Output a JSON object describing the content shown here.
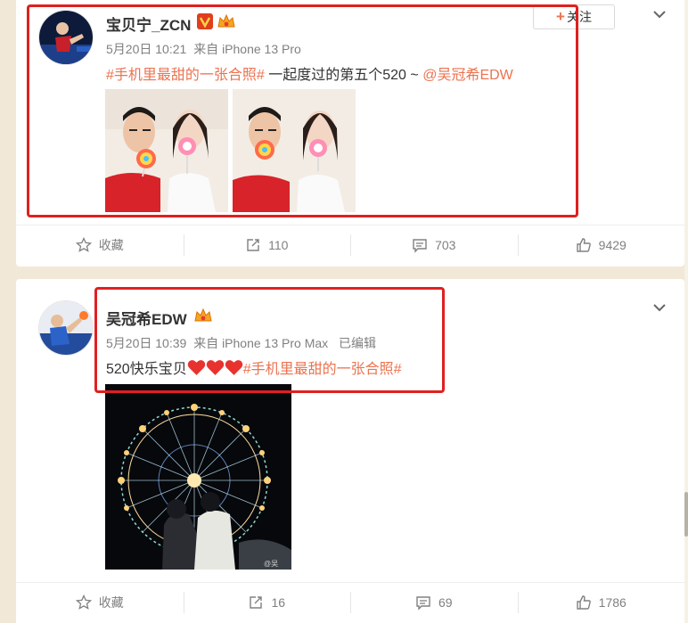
{
  "posts": [
    {
      "author": "宝贝宁_ZCN",
      "time": "5月20日 10:21",
      "source": "来自 iPhone 13 Pro",
      "text_topic": "#手机里最甜的一张合照#",
      "text_body": " 一起度过的第五个520 ~ ",
      "text_mention": "@吴冠希EDW",
      "follow_label": "关注",
      "actions": {
        "fav": "收藏",
        "repost": "110",
        "comment": "703",
        "like": "9429"
      }
    },
    {
      "author": "吴冠希EDW",
      "time": "5月20日 10:39",
      "source": "来自 iPhone 13 Pro Max",
      "edited": "已编辑",
      "text_body": "520快乐宝贝",
      "text_topic": "#手机里最甜的一张合照#",
      "watermark": "@吴",
      "actions": {
        "fav": "收藏",
        "repost": "16",
        "comment": "69",
        "like": "1786"
      }
    }
  ],
  "colors": {
    "accent": "#eb7350",
    "highlight": "#e02020",
    "background": "#f1e8d7"
  },
  "icons": [
    "verified-v-icon",
    "member-crown-icon",
    "chevron-down-icon",
    "star-icon",
    "repost-icon",
    "comment-icon",
    "like-icon",
    "heart-icon"
  ]
}
